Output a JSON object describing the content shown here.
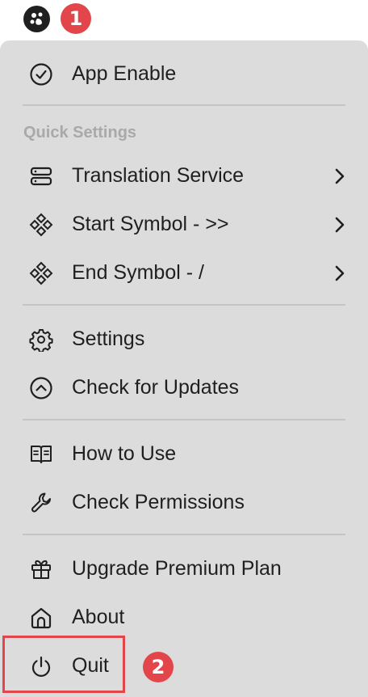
{
  "header": {
    "app_icon": "app-logo-icon",
    "badge1": "1"
  },
  "menu": {
    "app_enable": {
      "label": "App Enable",
      "icon": "check-circle-icon"
    },
    "quick_settings_header": "Quick Settings",
    "translation_service": {
      "label": "Translation Service",
      "icon": "server-icon"
    },
    "start_symbol": {
      "label": "Start Symbol - >>",
      "icon": "diamond-dots-icon"
    },
    "end_symbol": {
      "label": "End Symbol - /",
      "icon": "diamond-dots-icon"
    },
    "settings": {
      "label": "Settings",
      "icon": "gear-icon"
    },
    "check_updates": {
      "label": "Check for Updates",
      "icon": "chevron-up-circle-icon"
    },
    "how_to_use": {
      "label": "How to Use",
      "icon": "book-icon"
    },
    "check_permissions": {
      "label": "Check Permissions",
      "icon": "wrench-icon"
    },
    "upgrade": {
      "label": "Upgrade Premium Plan",
      "icon": "gift-icon"
    },
    "about": {
      "label": "About",
      "icon": "home-icon"
    },
    "quit": {
      "label": "Quit",
      "icon": "power-icon"
    }
  },
  "annotation": {
    "badge2": "2",
    "highlight_color": "#e2464b"
  },
  "colors": {
    "menu_bg": "#dcdcdc",
    "text": "#1f1f1f",
    "section_header": "#a9a9a9",
    "badge": "#e2464b"
  }
}
